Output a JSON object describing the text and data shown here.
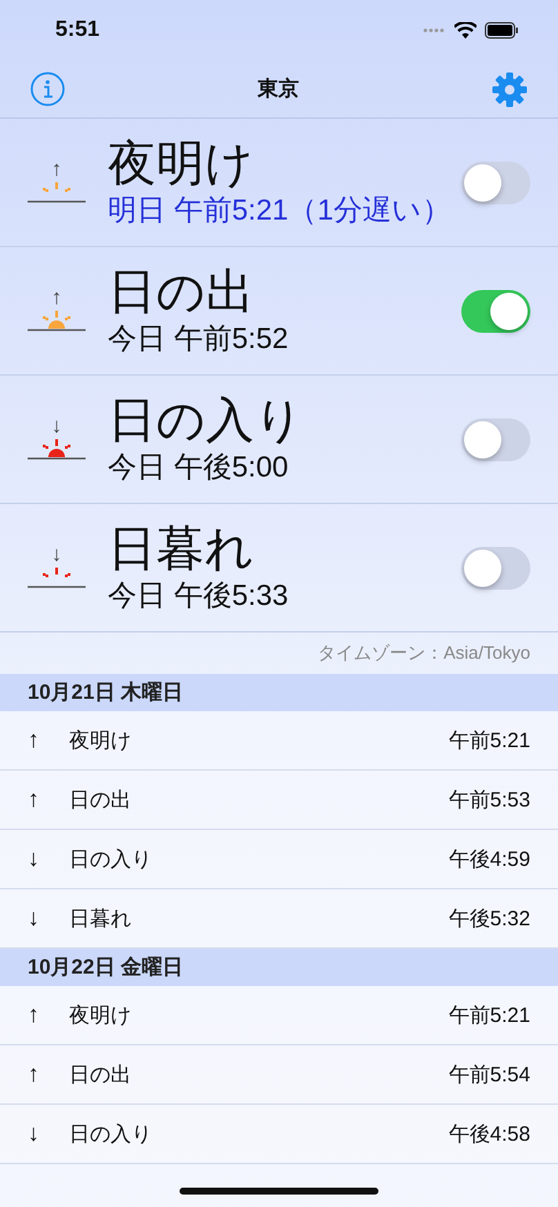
{
  "status_bar": {
    "time": "5:51"
  },
  "nav": {
    "title": "東京"
  },
  "events": [
    {
      "kind": "dawn",
      "arrow": "↑",
      "color": "#f7a53c",
      "name": "夜明け",
      "time": "明日 午前5:21（1分遅い）",
      "next": true,
      "on": false
    },
    {
      "kind": "sunrise",
      "arrow": "↑",
      "color": "#f7a53c",
      "name": "日の出",
      "time": "今日 午前5:52",
      "next": false,
      "on": true
    },
    {
      "kind": "sunset",
      "arrow": "↓",
      "color": "#e8231a",
      "name": "日の入り",
      "time": "今日 午後5:00",
      "next": false,
      "on": false
    },
    {
      "kind": "dusk",
      "arrow": "↓",
      "color": "#e8231a",
      "name": "日暮れ",
      "time": "今日 午後5:33",
      "next": false,
      "on": false
    }
  ],
  "timezone": "タイムゾーン：Asia/Tokyo",
  "days": [
    {
      "date": "10月21日 木曜日",
      "items": [
        {
          "arrow": "↑",
          "name": "夜明け",
          "time": "午前5:21"
        },
        {
          "arrow": "↑",
          "name": "日の出",
          "time": "午前5:53"
        },
        {
          "arrow": "↓",
          "name": "日の入り",
          "time": "午後4:59"
        },
        {
          "arrow": "↓",
          "name": "日暮れ",
          "time": "午後5:32"
        }
      ]
    },
    {
      "date": "10月22日 金曜日",
      "items": [
        {
          "arrow": "↑",
          "name": "夜明け",
          "time": "午前5:21"
        },
        {
          "arrow": "↑",
          "name": "日の出",
          "time": "午前5:54"
        },
        {
          "arrow": "↓",
          "name": "日の入り",
          "time": "午後4:58"
        }
      ]
    }
  ]
}
